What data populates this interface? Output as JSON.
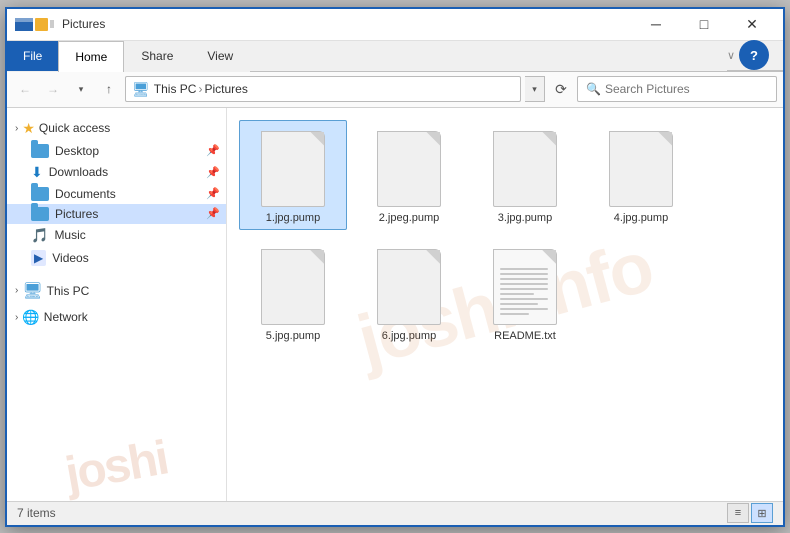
{
  "window": {
    "title": "Pictures",
    "minimize_label": "─",
    "maximize_label": "□",
    "close_label": "✕"
  },
  "ribbon": {
    "file_tab": "File",
    "tabs": [
      "Home",
      "Share",
      "View"
    ],
    "active_tab": "Home",
    "help_label": "?"
  },
  "address_bar": {
    "back_label": "←",
    "forward_label": "→",
    "dropdown_label": "▾",
    "up_label": "↑",
    "path": [
      "This PC",
      "Pictures"
    ],
    "refresh_label": "⟳",
    "search_placeholder": "Search Pictures"
  },
  "sidebar": {
    "quick_access_label": "Quick access",
    "items": [
      {
        "name": "Desktop",
        "icon": "folder",
        "pinned": true
      },
      {
        "name": "Downloads",
        "icon": "download",
        "pinned": true
      },
      {
        "name": "Documents",
        "icon": "folder",
        "pinned": true
      },
      {
        "name": "Pictures",
        "icon": "folder",
        "pinned": true,
        "active": true
      },
      {
        "name": "Music",
        "icon": "music"
      },
      {
        "name": "Videos",
        "icon": "video"
      }
    ],
    "this_pc_label": "This PC",
    "network_label": "Network"
  },
  "files": [
    {
      "name": "1.jpg.pump",
      "type": "generic",
      "selected": true
    },
    {
      "name": "2.jpeg.pump",
      "type": "generic",
      "selected": false
    },
    {
      "name": "3.jpg.pump",
      "type": "generic",
      "selected": false
    },
    {
      "name": "4.jpg.pump",
      "type": "generic",
      "selected": false
    },
    {
      "name": "5.jpg.pump",
      "type": "generic",
      "selected": false
    },
    {
      "name": "6.jpg.pump",
      "type": "generic",
      "selected": false
    },
    {
      "name": "README.txt",
      "type": "text",
      "selected": false
    }
  ],
  "status_bar": {
    "item_count": "7 items",
    "view_list_label": "≡",
    "view_grid_label": "⊞"
  }
}
